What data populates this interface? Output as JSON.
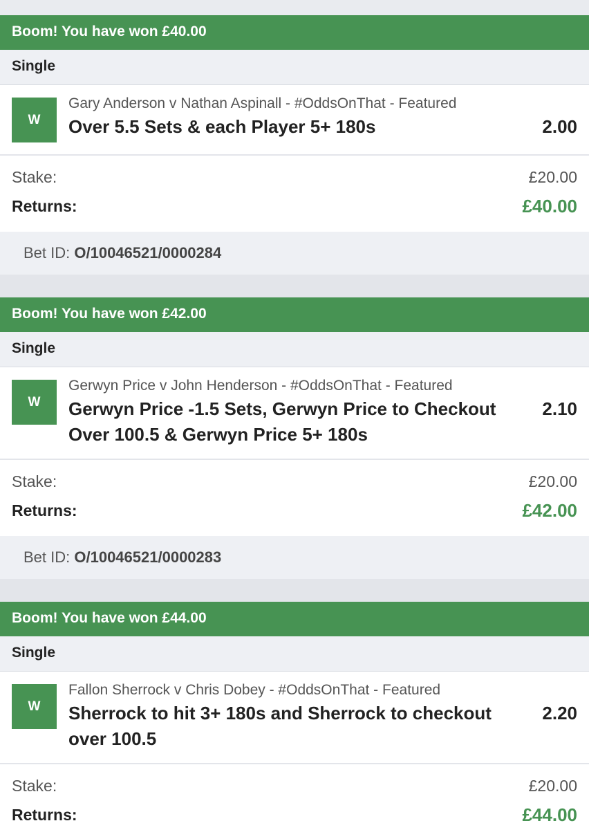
{
  "bets": [
    {
      "banner": "Boom! You have won £40.00",
      "bet_type": "Single",
      "result_badge": "W",
      "event": "Gary Anderson v Nathan Aspinall - #OddsOnThat - Featured",
      "market": "Over 5.5 Sets & each Player 5+ 180s",
      "odds": "2.00",
      "stake_label": "Stake:",
      "stake": "£20.00",
      "returns_label": "Returns:",
      "returns": "£40.00",
      "bet_id_label": "Bet ID:",
      "bet_id": "O/10046521/0000284"
    },
    {
      "banner": "Boom! You have won £42.00",
      "bet_type": "Single",
      "result_badge": "W",
      "event": "Gerwyn Price v John Henderson - #OddsOnThat - Featured",
      "market": "Gerwyn Price -1.5 Sets, Gerwyn Price to Checkout Over 100.5 & Gerwyn Price 5+ 180s",
      "odds": "2.10",
      "stake_label": "Stake:",
      "stake": "£20.00",
      "returns_label": "Returns:",
      "returns": "£42.00",
      "bet_id_label": "Bet ID:",
      "bet_id": "O/10046521/0000283"
    },
    {
      "banner": "Boom! You have won £44.00",
      "bet_type": "Single",
      "result_badge": "W",
      "event": "Fallon Sherrock v Chris Dobey - #OddsOnThat - Featured",
      "market": "Sherrock to hit 3+ 180s and Sherrock to checkout over 100.5",
      "odds": "2.20",
      "stake_label": "Stake:",
      "stake": "£20.00",
      "returns_label": "Returns:",
      "returns": "£44.00"
    }
  ],
  "colors": {
    "win_green": "#479353",
    "background": "#e9ebef"
  }
}
